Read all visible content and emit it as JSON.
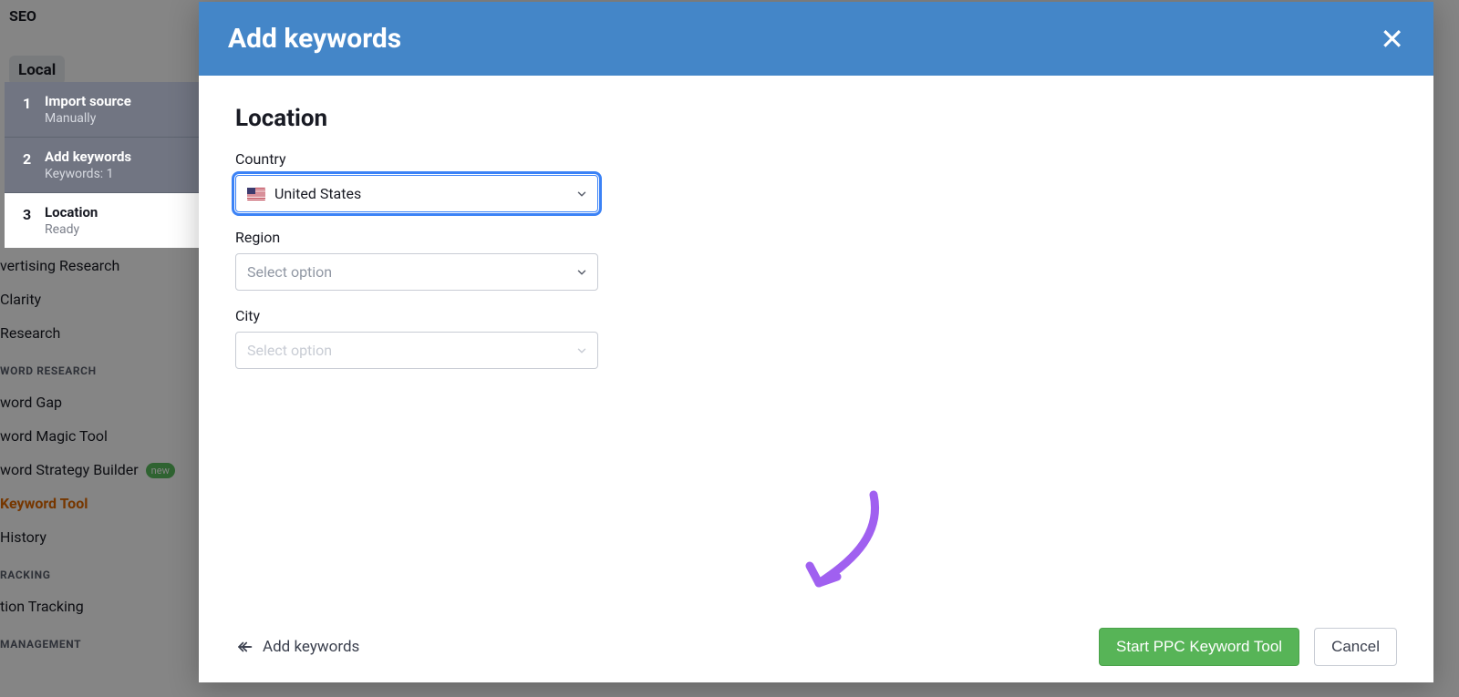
{
  "background": {
    "top_item": "SEO",
    "local_label": "Local",
    "nav": {
      "item1": "vertising Research",
      "item2": "Clarity",
      "item3": " Research",
      "cat1": "WORD RESEARCH",
      "item4": "word Gap",
      "item5": "word Magic Tool",
      "item6": "word Strategy Builder",
      "badge_new": "new",
      "item7": " Keyword Tool",
      "item8": " History",
      "cat2": "RACKING",
      "item9": "tion Tracking",
      "cat3": "MANAGEMENT"
    }
  },
  "modal": {
    "title": "Add keywords",
    "steps": [
      {
        "num": "1",
        "title": "Import source",
        "sub": "Manually"
      },
      {
        "num": "2",
        "title": "Add keywords",
        "sub": "Keywords: 1"
      },
      {
        "num": "3",
        "title": "Location",
        "sub": "Ready"
      }
    ],
    "form": {
      "section_title": "Location",
      "country_label": "Country",
      "country_value": "United States",
      "region_label": "Region",
      "region_placeholder": "Select option",
      "city_label": "City",
      "city_placeholder": "Select option"
    },
    "footer": {
      "back_label": "Add keywords",
      "primary": "Start PPC Keyword Tool",
      "cancel": "Cancel"
    }
  }
}
